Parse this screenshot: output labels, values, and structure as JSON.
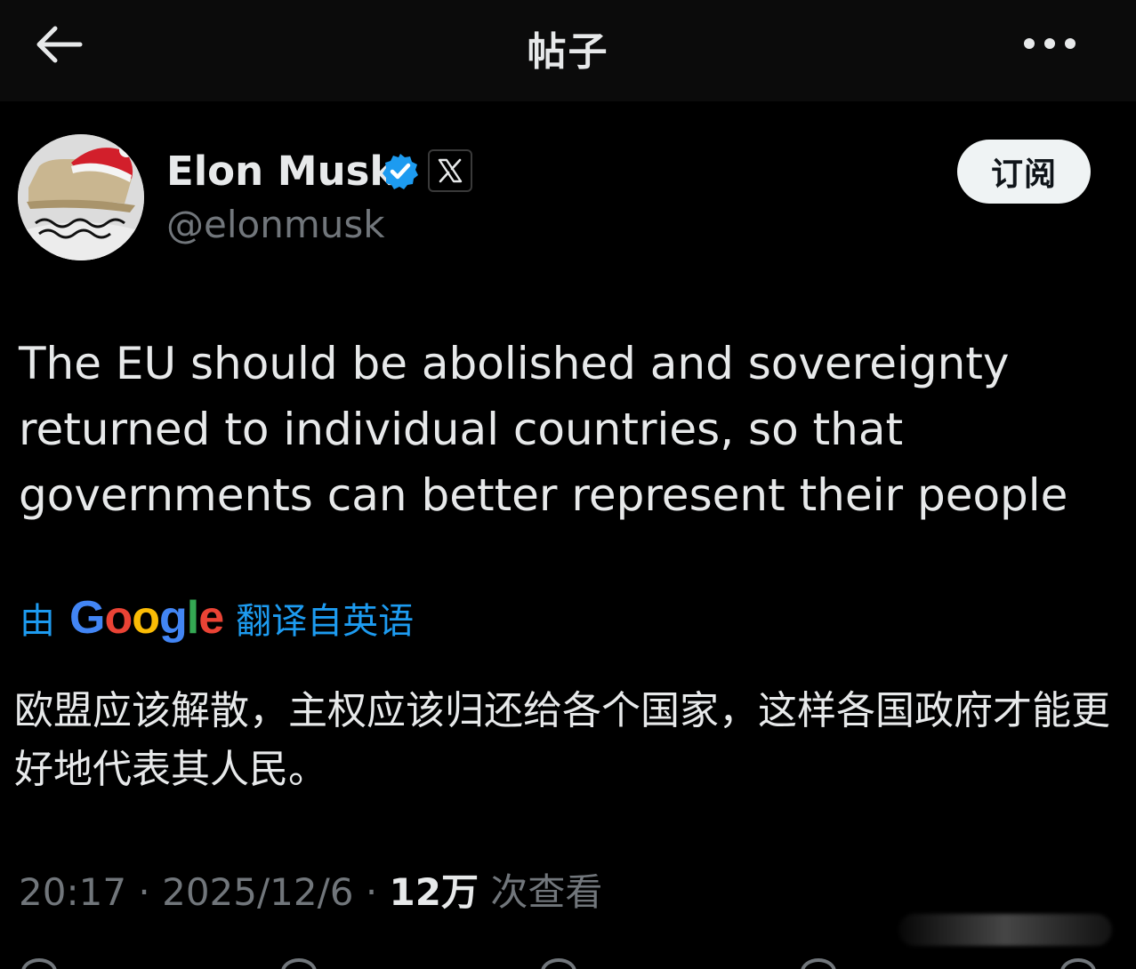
{
  "header": {
    "title": "帖子",
    "back_icon": "arrow-left-icon",
    "more_icon": "more-horizontal-icon"
  },
  "author": {
    "name": "Elon Musk",
    "handle": "@elonmusk",
    "verified_icon": "verified-badge-icon",
    "affiliate_icon": "x-logo-icon",
    "subscribe_label": "订阅",
    "avatar_icon": "avatar-image"
  },
  "post": {
    "text": "The EU should be abolished and sovereignty returned to individual countries, so that governments can better represent their people",
    "translation": {
      "prefix": "由",
      "provider": "Google",
      "suffix": "翻译自英语",
      "text": "欧盟应该解散，主权应该归还给各个国家，这样各国政府才能更好地代表其人民。"
    },
    "meta": {
      "time": "20:17",
      "separator": " · ",
      "date": "2025/12/6",
      "views_count": "12万",
      "views_label": " 次查看"
    }
  },
  "colors": {
    "background": "#000000",
    "text_primary": "#e7e9ea",
    "text_secondary": "#71767b",
    "accent_blue": "#1d9bf0",
    "google_blue": "#4285f4",
    "google_red": "#ea4335",
    "google_yellow": "#fbbc05",
    "google_green": "#34a853"
  }
}
